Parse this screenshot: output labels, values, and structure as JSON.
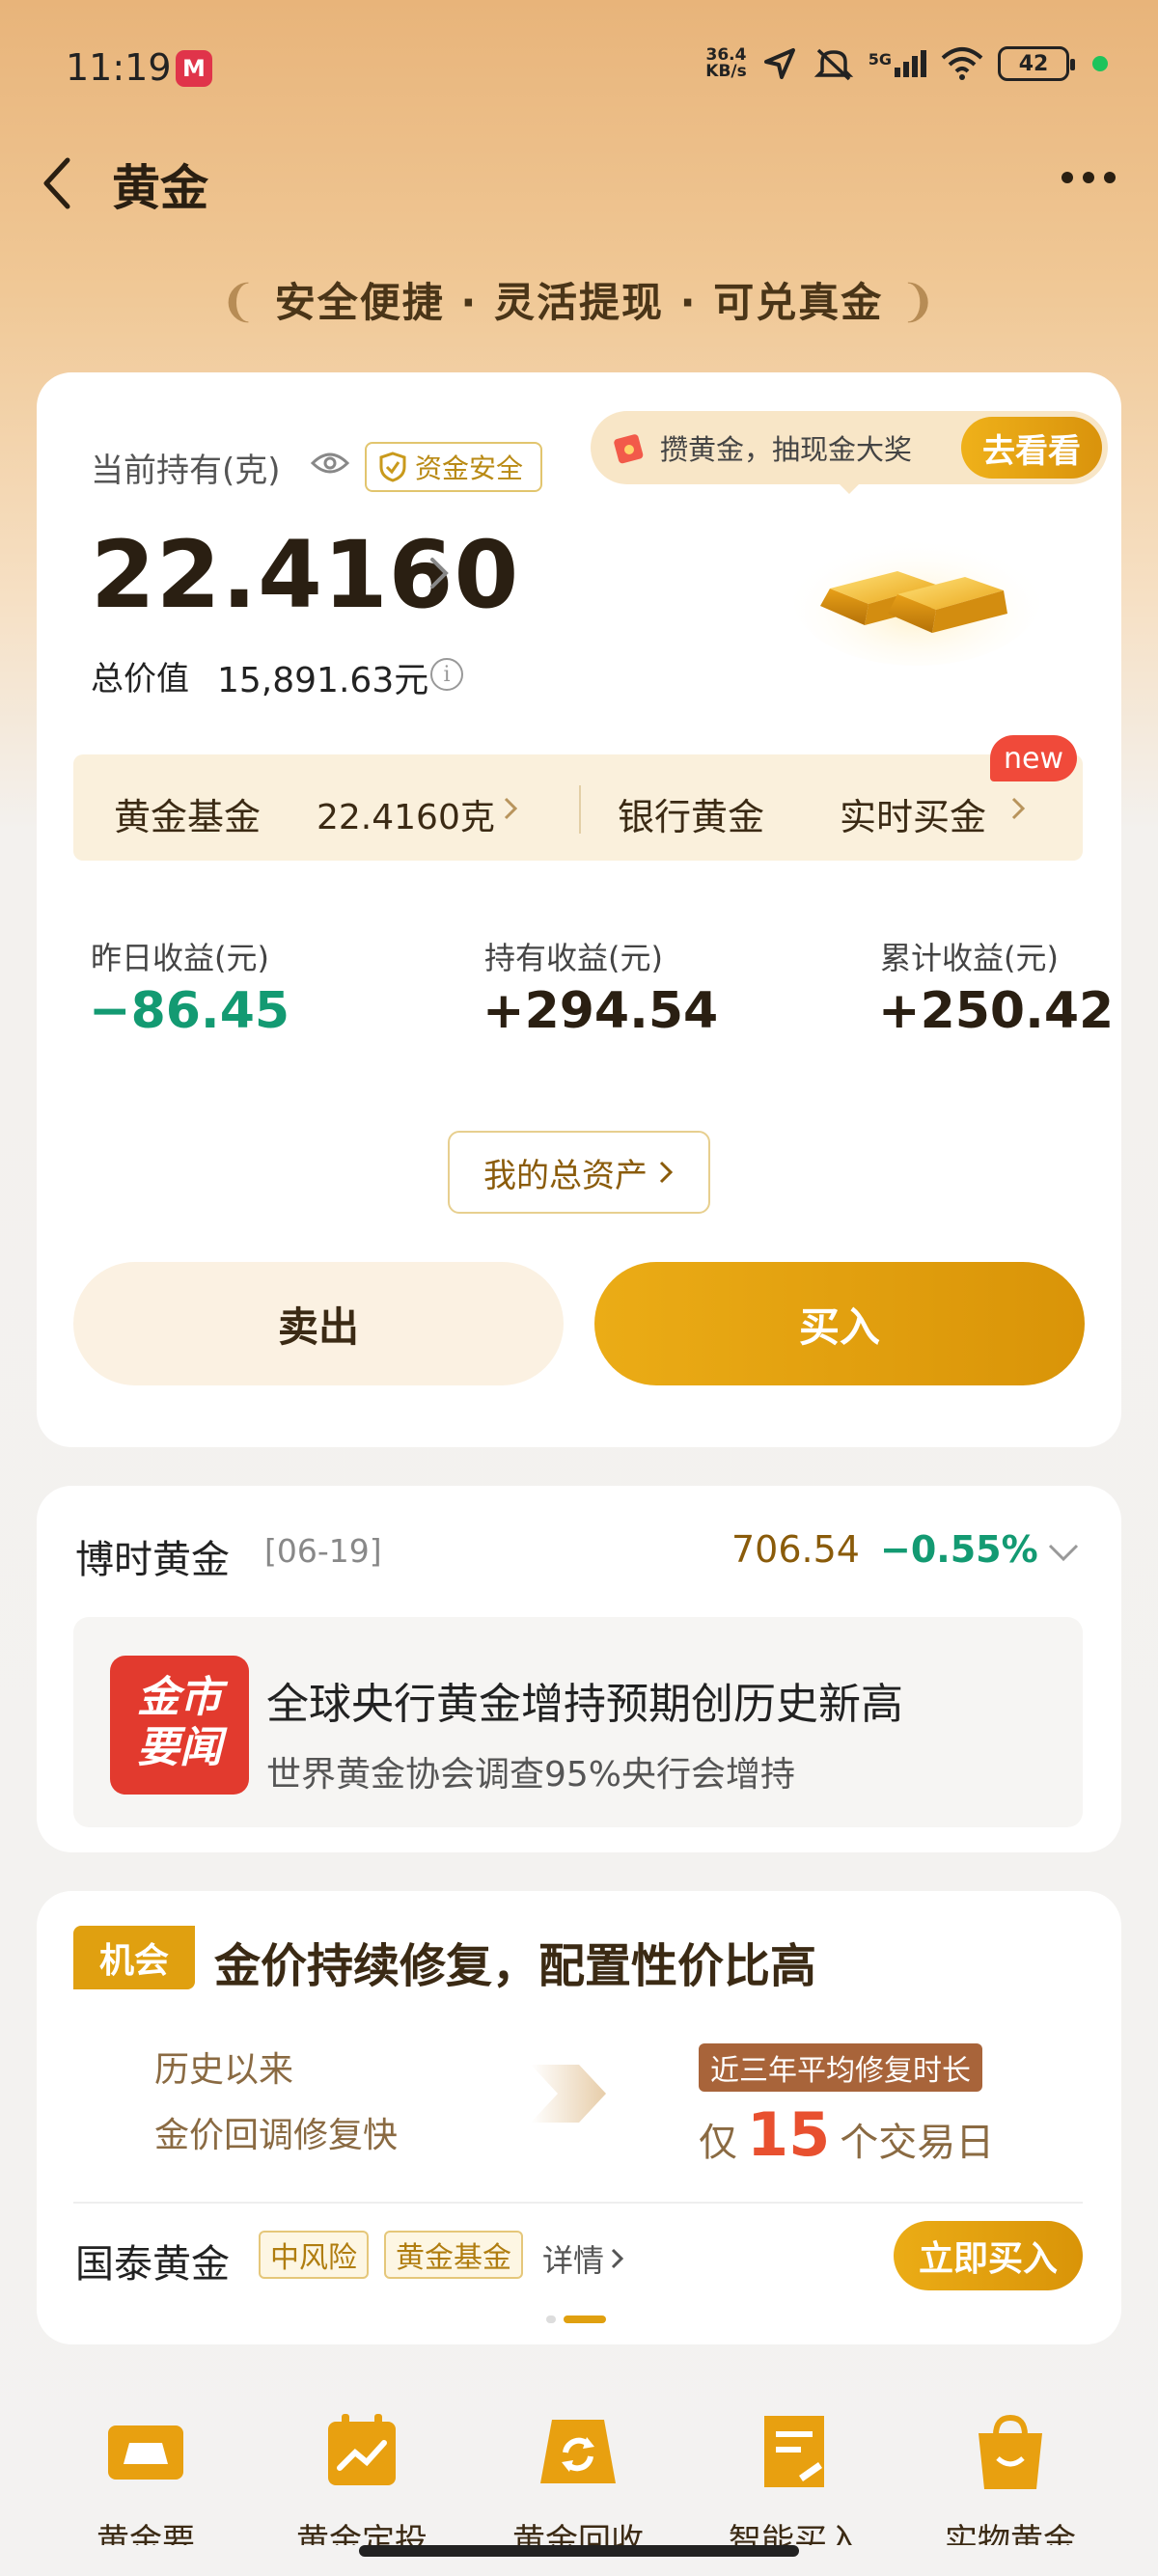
{
  "status_bar": {
    "time": "11:19",
    "app_icon_glyph": "M",
    "net_speed_value": "36.4",
    "net_speed_unit": "KB/s",
    "signal_label": "5G",
    "battery": "42"
  },
  "header": {
    "title": "黄金"
  },
  "slogan": {
    "text": "安全便捷 · 灵活提现 · 可兑真金"
  },
  "holdings": {
    "label": "当前持有(克)",
    "safe_badge": "资金安全",
    "amount": "22.4160",
    "total_label": "总价值",
    "total_value": "15,891.63元",
    "info_glyph": "i"
  },
  "promo": {
    "text": "攒黄金，抽现金大奖",
    "button": "去看看"
  },
  "fund_bar": {
    "fund_name": "黄金基金",
    "fund_grams": "22.4160克",
    "bank_name": "银行黄金",
    "realtime": "实时买金",
    "new_badge": "new"
  },
  "stats": [
    {
      "label": "昨日收益(元)",
      "value": "−86.45"
    },
    {
      "label": "持有收益(元)",
      "value": "+294.54"
    },
    {
      "label": "累计收益(元)",
      "value": "+250.42"
    }
  ],
  "actions": {
    "my_assets": "我的总资产",
    "sell": "卖出",
    "buy": "买入"
  },
  "fund_quote": {
    "name": "博时黄金",
    "date": "[06-19]",
    "price": "706.54",
    "change": "−0.55%"
  },
  "news": {
    "icon_line1": "金市",
    "icon_line2": "要闻",
    "title": "全球央行黄金增持预期创历史新高",
    "subtitle": "世界黄金协会调查95%央行会增持"
  },
  "opportunity": {
    "tag": "机会",
    "title": "金价持续修复，配置性价比高",
    "left_line1": "历史以来",
    "left_line2": "金价回调修复快",
    "right_tag": "近三年平均修复时长",
    "right_prefix": "仅",
    "right_number": "15",
    "right_suffix": "个交易日",
    "fund_name": "国泰黄金",
    "tag_risk": "中风险",
    "tag_type": "黄金基金",
    "detail": "详情",
    "buy_now": "立即买入"
  },
  "bottom_nav": [
    {
      "label": "黄金要",
      "icon": "gold-ingot-icon"
    },
    {
      "label": "黄金定投",
      "icon": "calendar-chart-icon"
    },
    {
      "label": "黄金回收",
      "icon": "recycle-icon"
    },
    {
      "label": "智能买入",
      "icon": "smart-doc-icon"
    },
    {
      "label": "实物黄金",
      "icon": "shopping-bag-icon"
    }
  ],
  "colors": {
    "accent_gold": "#e0a010",
    "negative_green": "#139a72",
    "brand_brown": "#3b2a14"
  }
}
